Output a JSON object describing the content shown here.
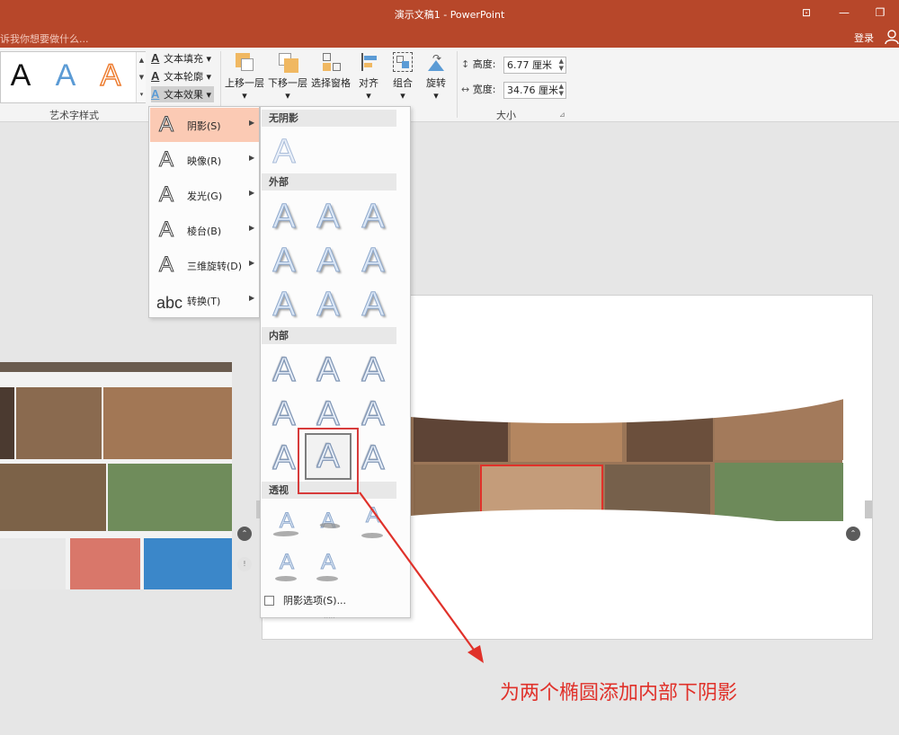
{
  "window": {
    "title": "演示文稿1 - PowerPoint",
    "tell_me": "诉我你想要做什么...",
    "login": "登录"
  },
  "ribbon": {
    "wordart_samples": [
      "A",
      "A",
      "A"
    ],
    "wordart_colors": [
      "#111111",
      "#5b9bd5",
      "#ed7d31"
    ],
    "text_fill": "文本填充",
    "text_outline": "文本轮廓",
    "text_effect": "文本效果",
    "wordart_group": "艺术字样式",
    "arrange": {
      "bring_forward": "上移一层",
      "send_backward": "下移一层",
      "selection_pane": "选择窗格",
      "align": "对齐",
      "group": "组合",
      "rotate": "旋转"
    },
    "size": {
      "height_label": "高度:",
      "height_value": "6.77 厘米",
      "width_label": "宽度:",
      "width_value": "34.76 厘米",
      "group_label": "大小"
    }
  },
  "effect_menu": [
    {
      "icon": "A",
      "label": "阴影(S)"
    },
    {
      "icon": "A",
      "label": "映像(R)"
    },
    {
      "icon": "A",
      "label": "发光(G)"
    },
    {
      "icon": "A",
      "label": "棱台(B)"
    },
    {
      "icon": "A",
      "label": "三维旋转(D)"
    },
    {
      "icon": "abc",
      "label": "转换(T)"
    }
  ],
  "shadow_panel": {
    "no_shadow": "无阴影",
    "outer": "外部",
    "inner": "内部",
    "perspective": "透视",
    "sample": "A",
    "options": "阴影选项(S)...",
    "grip": "....."
  },
  "annotation": "为两个椭圆添加内部下阴影",
  "colors": {
    "accent": "#b7472a",
    "highlight": "#fbcab4",
    "annotation": "#e0312a"
  }
}
